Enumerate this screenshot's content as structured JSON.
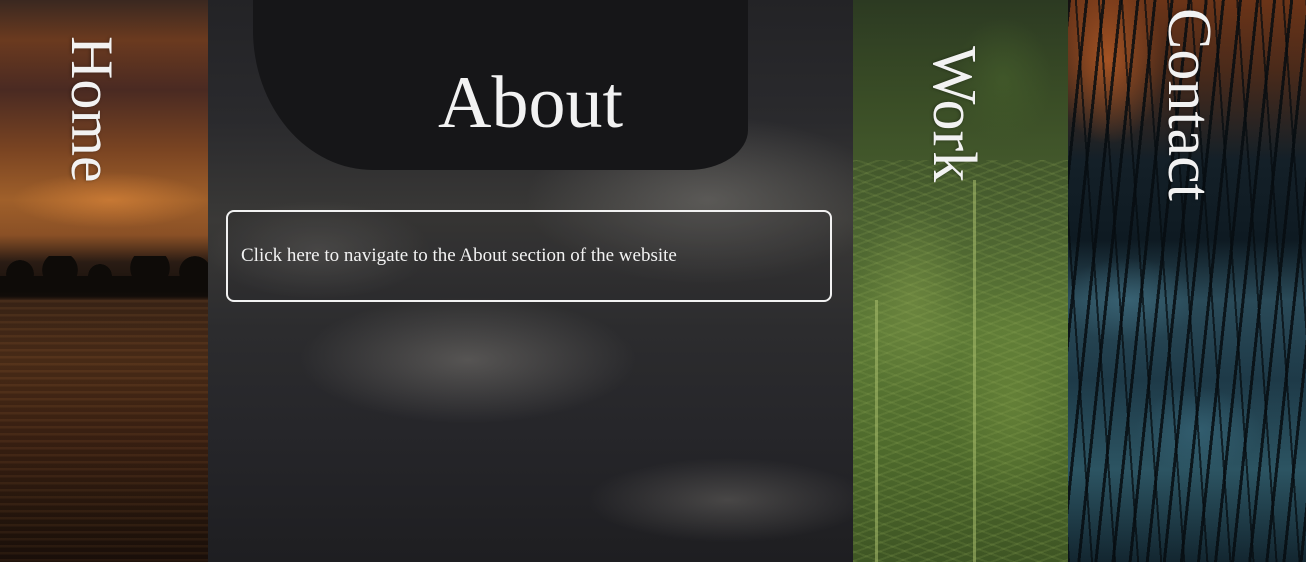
{
  "nav": {
    "home": {
      "label": "Home"
    },
    "about": {
      "label": "About",
      "description": "Click here to navigate to the About section of the website"
    },
    "work": {
      "label": "Work"
    },
    "contact": {
      "label": "Contact"
    }
  }
}
